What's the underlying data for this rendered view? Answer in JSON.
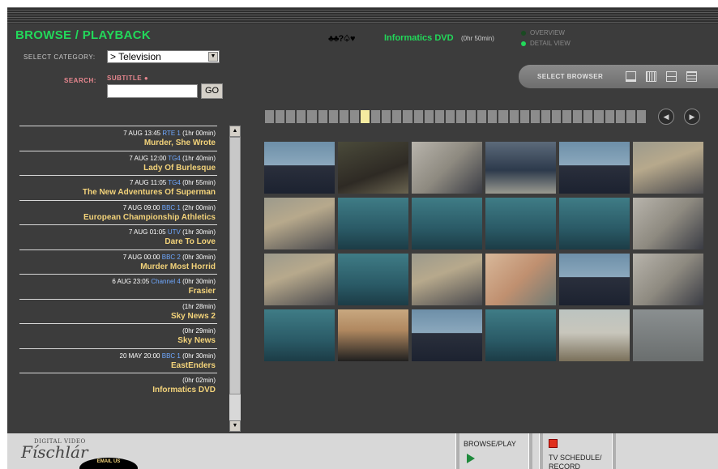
{
  "header": {
    "title": "BROWSE / PLAYBACK",
    "category_label": "SELECT CATEGORY:",
    "category_value": "> Television",
    "search_label": "SEARCH:",
    "subtitle_label": "SUBTITLE",
    "search_value": "",
    "go_label": "GO"
  },
  "program": {
    "logo_glyphs": "♣♣?♤♥",
    "title": "Informatics DVD",
    "duration": "(0hr 50min)"
  },
  "views": {
    "overview": "OVERVIEW",
    "detail": "DETAIL VIEW",
    "select_browser": "SELECT BROWSER"
  },
  "programs": [
    {
      "meta": "7 AUG 13:45",
      "channel": "RTE 1",
      "duration": "(1hr 00min)",
      "name": "Murder, She Wrote"
    },
    {
      "meta": "7 AUG 12:00",
      "channel": "TG4",
      "duration": "(1hr 40min)",
      "name": "Lady Of Burlesque"
    },
    {
      "meta": "7 AUG 11:05",
      "channel": "TG4",
      "duration": "(0hr 55min)",
      "name": "The New Adventures Of Superman"
    },
    {
      "meta": "7 AUG 09:00",
      "channel": "BBC 1",
      "duration": "(2hr 00min)",
      "name": "European Championship Athletics"
    },
    {
      "meta": "7 AUG 01:05",
      "channel": "UTV",
      "duration": "(1hr 30min)",
      "name": "Dare To Love"
    },
    {
      "meta": "7 AUG 00:00",
      "channel": "BBC 2",
      "duration": "(0hr 30min)",
      "name": "Murder Most Horrid"
    },
    {
      "meta": "6 AUG 23:05",
      "channel": "Channel 4",
      "duration": "(0hr 30min)",
      "name": "Frasier"
    },
    {
      "meta": "",
      "channel": "",
      "duration": "(1hr 28min)",
      "name": "Sky News 2"
    },
    {
      "meta": "",
      "channel": "",
      "duration": "(0hr 29min)",
      "name": "Sky News"
    },
    {
      "meta": "20 MAY 20:00",
      "channel": "BBC 1",
      "duration": "(0hr 30min)",
      "name": "EastEnders"
    },
    {
      "meta": "",
      "channel": "",
      "duration": "(0hr 02min)",
      "name": "Informatics DVD"
    }
  ],
  "scroll": {
    "up": "▲",
    "down": "▼"
  },
  "nav": {
    "prev": "◀",
    "next": "▶"
  },
  "bottom": {
    "logo_small": "DIGITAL VIDEO",
    "logo": "Físchlár",
    "email": "EMAIL US",
    "browse_play": "BROWSE/PLAY",
    "tv_schedule_1": "TV SCHEDULE/",
    "tv_schedule_2": "RECORD"
  },
  "colors": {
    "accent": "#22d85a",
    "program_name": "#f3d37a",
    "channel": "#6fa8ff"
  }
}
